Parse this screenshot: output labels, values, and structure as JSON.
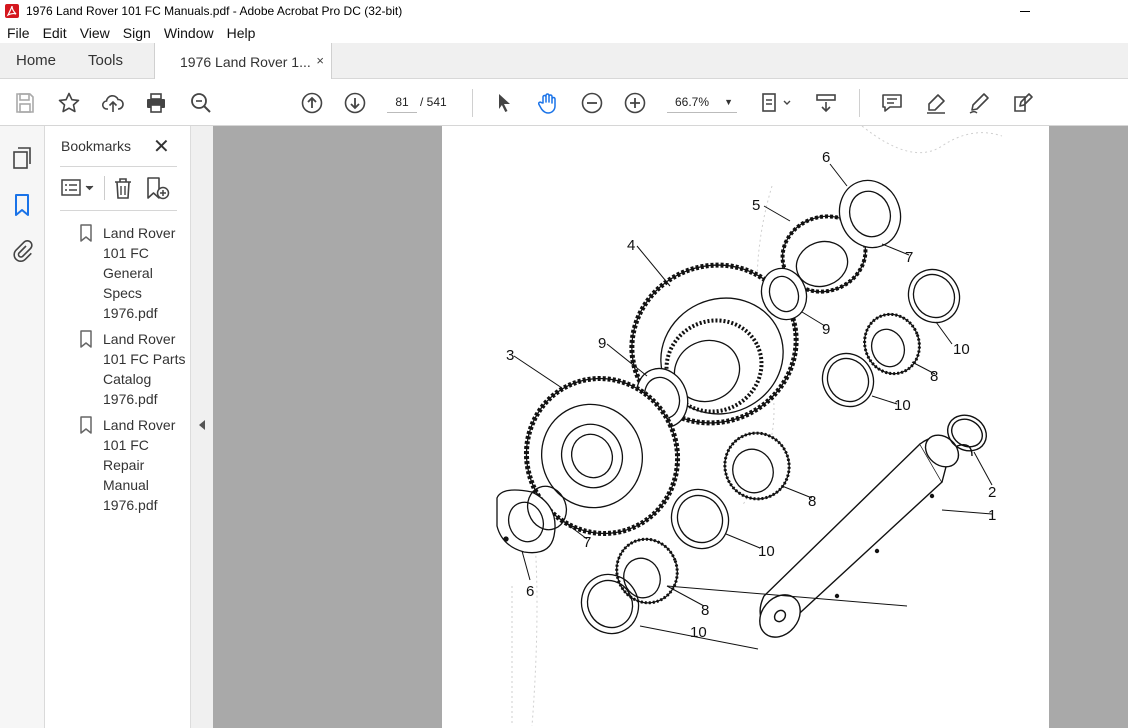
{
  "window": {
    "title": "1976 Land Rover 101 FC Manuals.pdf - Adobe Acrobat Pro DC (32-bit)"
  },
  "menu": [
    "File",
    "Edit",
    "View",
    "Sign",
    "Window",
    "Help"
  ],
  "tabs": {
    "home": "Home",
    "tools": "Tools",
    "document": "1976 Land Rover 1...",
    "close": "×"
  },
  "toolbar": {
    "current_page": "81",
    "page_total": "/ 541",
    "zoom": "66.7%",
    "icons": [
      "save-icon",
      "star-icon",
      "upload-icon",
      "print-icon",
      "zoom-search-icon",
      "page-up-icon",
      "page-down-icon",
      "select-cursor-icon",
      "hand-icon",
      "zoom-out-icon",
      "zoom-in-icon",
      "fit-page-icon",
      "scroll-mode-icon",
      "comment-icon",
      "highlight-icon",
      "sign-icon",
      "fill-sign-icon"
    ]
  },
  "bookmarks": {
    "title": "Bookmarks",
    "close": "✕",
    "items": [
      {
        "label": "Land Rover 101 FC General Specs 1976.pdf"
      },
      {
        "label": "Land Rover 101 FC Parts Catalog 1976.pdf"
      },
      {
        "label": "Land Rover 101 FC Repair Manual 1976.pdf"
      }
    ]
  },
  "diagram": {
    "callouts": [
      "6",
      "5",
      "4",
      "7",
      "9",
      "10",
      "3",
      "9",
      "8",
      "10",
      "2",
      "1",
      "8",
      "7",
      "10",
      "6",
      "8",
      "10"
    ]
  }
}
